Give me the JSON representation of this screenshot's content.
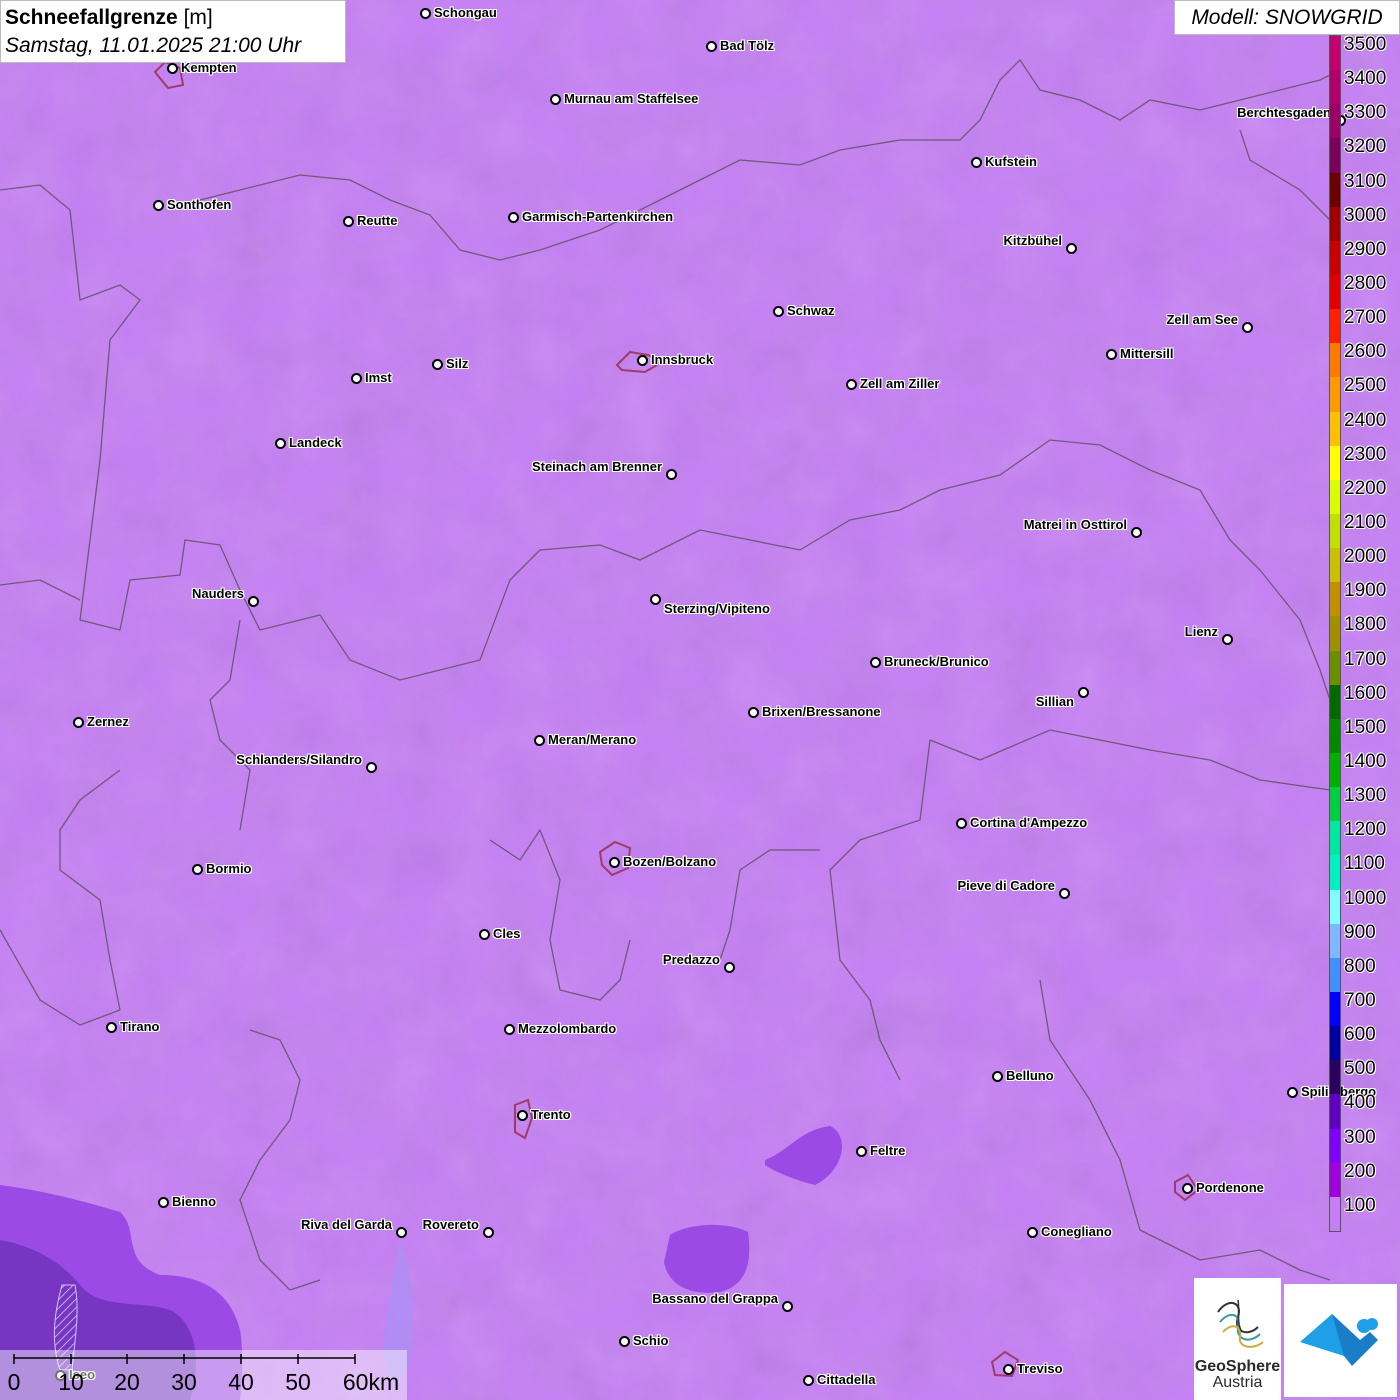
{
  "header": {
    "title_bold": "Schneefallgrenze",
    "title_unit": "[m]",
    "datetime": "Samstag, 11.01.2025 21:00 Uhr",
    "model": "Modell: SNOWGRID"
  },
  "colors": {
    "field_main": "#c57ef5",
    "field_low": "#9b4ae6",
    "field_lowest": "#6a2ab3",
    "border_lines": "#6e5a78",
    "urban_outline": "#a03a6a"
  },
  "places": [
    {
      "name": "Schongau"
    },
    {
      "name": "Bad Tölz"
    },
    {
      "name": "Kempten"
    },
    {
      "name": "Murnau am Staffelsee"
    },
    {
      "name": "Berchtesgaden"
    },
    {
      "name": "Kufstein"
    },
    {
      "name": "Sonthofen"
    },
    {
      "name": "Reutte"
    },
    {
      "name": "Garmisch-Partenkirchen"
    },
    {
      "name": "Kitzbühel"
    },
    {
      "name": "Schwaz"
    },
    {
      "name": "Zell am See"
    },
    {
      "name": "Innsbruck"
    },
    {
      "name": "Mittersill"
    },
    {
      "name": "Imst"
    },
    {
      "name": "Silz"
    },
    {
      "name": "Zell am Ziller"
    },
    {
      "name": "Landeck"
    },
    {
      "name": "Steinach am Brenner"
    },
    {
      "name": "Matrei in Osttirol"
    },
    {
      "name": "Nauders"
    },
    {
      "name": "Sterzing/Vipiteno"
    },
    {
      "name": "Lienz"
    },
    {
      "name": "Bruneck/Brunico"
    },
    {
      "name": "Sillian"
    },
    {
      "name": "Zernez"
    },
    {
      "name": "Brixen/Bressanone"
    },
    {
      "name": "Meran/Merano"
    },
    {
      "name": "Schlanders/Silandro"
    },
    {
      "name": "Cortina d'Ampezzo"
    },
    {
      "name": "Bozen/Bolzano"
    },
    {
      "name": "Bormio"
    },
    {
      "name": "Pieve di Cadore"
    },
    {
      "name": "Cles"
    },
    {
      "name": "Predazzo"
    },
    {
      "name": "Tirano"
    },
    {
      "name": "Mezzolombardo"
    },
    {
      "name": "Belluno"
    },
    {
      "name": "Spilimbergo"
    },
    {
      "name": "Trento"
    },
    {
      "name": "Feltre"
    },
    {
      "name": "Pordenone"
    },
    {
      "name": "Bienno"
    },
    {
      "name": "Riva del Garda"
    },
    {
      "name": "Rovereto"
    },
    {
      "name": "Conegliano"
    },
    {
      "name": "Bassano del Grappa"
    },
    {
      "name": "Schio"
    },
    {
      "name": "Treviso"
    },
    {
      "name": "Cittadella"
    },
    {
      "name": "Iseo"
    }
  ],
  "legend": {
    "unit": "m",
    "labels": [
      "3500",
      "3400",
      "3300",
      "3200",
      "3100",
      "3000",
      "2900",
      "2800",
      "2700",
      "2600",
      "2500",
      "2400",
      "2300",
      "2200",
      "2100",
      "2000",
      "1900",
      "1800",
      "1700",
      "1600",
      "1500",
      "1400",
      "1300",
      "1200",
      "1100",
      "1000",
      "900",
      "800",
      "700",
      "600",
      "500",
      "400",
      "300",
      "200",
      "100"
    ],
    "colors": [
      "#c4006e",
      "#b0006a",
      "#9a0066",
      "#7a005a",
      "#6a0000",
      "#a00000",
      "#c80000",
      "#e00000",
      "#ff2000",
      "#ff7a00",
      "#ff9a00",
      "#ffc000",
      "#ffff00",
      "#d8ff00",
      "#c0e000",
      "#c8c000",
      "#c09000",
      "#a09000",
      "#6a9000",
      "#006a00",
      "#008a00",
      "#00b000",
      "#00d040",
      "#00e8a0",
      "#00f0c0",
      "#80ffff",
      "#80b8ff",
      "#4090ff",
      "#0000ff",
      "#0000a0",
      "#2a0060",
      "#6000c0",
      "#8000ff",
      "#a000e0",
      "#c57ef5"
    ]
  },
  "scale": {
    "ticks": [
      "0",
      "10",
      "20",
      "30",
      "40",
      "50",
      "60km"
    ]
  },
  "logos": {
    "geosphere_line1": "GeoSphere",
    "geosphere_line2": "Austria"
  }
}
